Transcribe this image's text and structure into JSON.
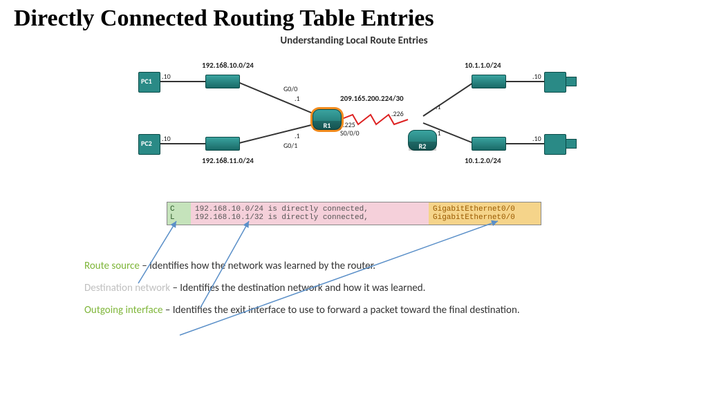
{
  "title": "Directly Connected Routing Table Entries",
  "subtitle": "Understanding Local Route Entries",
  "devices": {
    "pc1": "PC1",
    "pc2": "PC2",
    "r1": "R1",
    "r2": "R2"
  },
  "networks": {
    "n1": "192.168.10.0/24",
    "n2": "192.168.11.0/24",
    "wan": "209.165.200.224/30",
    "n3": "10.1.1.0/24",
    "n4": "10.1.2.0/24"
  },
  "hosts": {
    "pc1": ".10",
    "pc2": ".10",
    "pc3": ".10",
    "pc4": ".10",
    "g00": "G0/0",
    "g00_1": ".1",
    "g01": "G0/1",
    "g01_1": ".1",
    "s000_225": ".225",
    "s000": "S0/0/0",
    "s000_226": ".226",
    "r2u": ".1",
    "r2d": ".1"
  },
  "route_box": {
    "col1": {
      "l1": "C",
      "l2": "L"
    },
    "col2": {
      "l1": "192.168.10.0/24 is directly connected,",
      "l2": "192.168.10.1/32 is directly connected,"
    },
    "col3": {
      "l1": "GigabitEthernet0/0",
      "l2": "GigabitEthernet0/0"
    }
  },
  "explain": {
    "k1": "Route source",
    "t1": " – Identifies how the network was learned by the router.",
    "k2": "Destination network",
    "t2": " – Identifies the destination network and how it was learned.",
    "k3": "Outgoing interface",
    "t3": " – Identifies the exit interface to use to forward a packet toward the final destination."
  }
}
